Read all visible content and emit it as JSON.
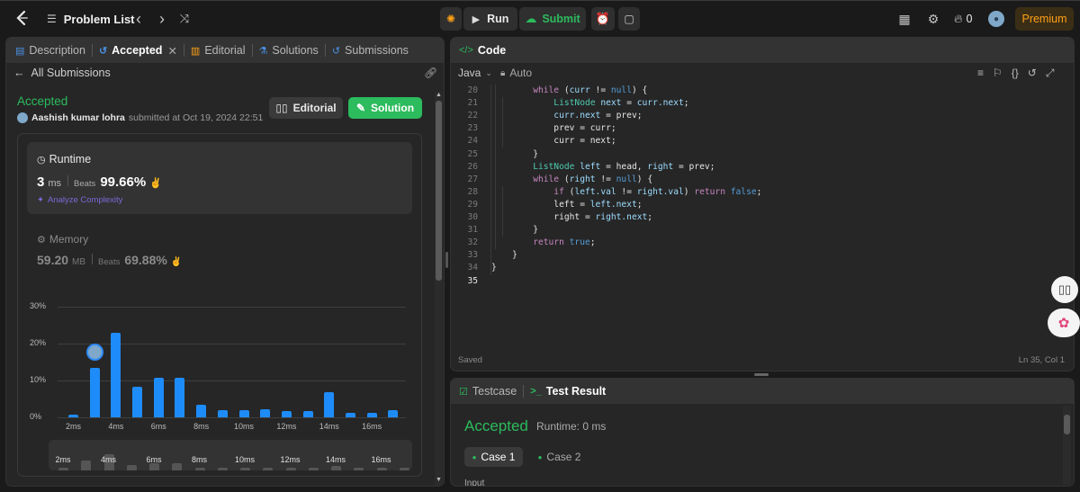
{
  "topbar": {
    "problem_list": "Problem List",
    "run": "Run",
    "submit": "Submit",
    "streak_count": "0",
    "premium": "Premium"
  },
  "left_tabs": [
    {
      "label": "Description"
    },
    {
      "label": "Accepted"
    },
    {
      "label": "Editorial"
    },
    {
      "label": "Solutions"
    },
    {
      "label": "Submissions"
    }
  ],
  "submission": {
    "back_label": "All Submissions",
    "status": "Accepted",
    "author": "Aashish kumar lohra",
    "submitted_text": "submitted at Oct 19, 2024 22:51",
    "editorial_btn": "Editorial",
    "solution_btn": "Solution",
    "runtime_title": "Runtime",
    "runtime_value": "3",
    "runtime_unit": "ms",
    "beats_label": "Beats",
    "runtime_beats": "99.66%",
    "analyze": "Analyze Complexity",
    "memory_title": "Memory",
    "memory_value": "59.20",
    "memory_unit": "MB",
    "memory_beats": "69.88%"
  },
  "chart_data": {
    "type": "bar",
    "ylabels": [
      "30%",
      "20%",
      "10%",
      "0%"
    ],
    "ylim": [
      0,
      30
    ],
    "xlabels": [
      "2ms",
      "4ms",
      "6ms",
      "8ms",
      "10ms",
      "12ms",
      "14ms",
      "16ms"
    ],
    "values": [
      0.8,
      13.5,
      23,
      8.3,
      10.8,
      10.8,
      3.3,
      2.0,
      2.0,
      2.2,
      1.6,
      1.6,
      6.8,
      1.2,
      1.2,
      2.0
    ],
    "highlight_index": 1,
    "mini_labels": [
      "2ms",
      "4ms",
      "6ms",
      "8ms",
      "10ms",
      "12ms",
      "14ms",
      "16ms"
    ]
  },
  "code_panel": {
    "title": "Code",
    "language": "Java",
    "mode": "Auto",
    "saved": "Saved",
    "cursor": "Ln 35, Col 1",
    "line_numbers": [
      "20",
      "21",
      "22",
      "23",
      "24",
      "25",
      "26",
      "27",
      "28",
      "29",
      "30",
      "31",
      "32",
      "33",
      "34",
      "35"
    ]
  },
  "test_panel": {
    "testcase_tab": "Testcase",
    "result_tab": "Test Result",
    "status": "Accepted",
    "runtime": "Runtime: 0 ms",
    "case1": "Case 1",
    "case2": "Case 2",
    "input_label": "Input"
  },
  "colors": {
    "accent_green": "#2cbb5d",
    "accent_blue": "#1e8cf8",
    "premium": "#ffa116"
  }
}
